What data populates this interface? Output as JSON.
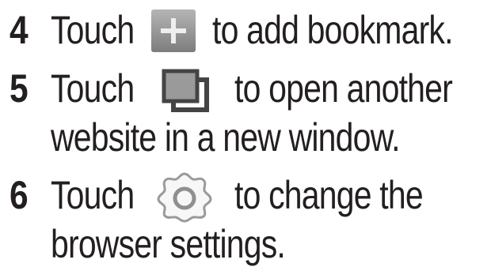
{
  "steps": [
    {
      "number": "4",
      "line1_before": "Touch",
      "icon": "add-bookmark-icon",
      "line1_after": "to add bookmark.",
      "line2": ""
    },
    {
      "number": "5",
      "line1_before": "Touch",
      "icon": "new-window-icon",
      "line1_after": "to open another",
      "line2": "website in a new window."
    },
    {
      "number": "6",
      "line1_before": "Touch",
      "icon": "settings-gear-icon",
      "line1_after": "to change the",
      "line2": "browser settings."
    }
  ],
  "colors": {
    "text": "#231f20",
    "icon_gray": "#8a8a8a"
  }
}
